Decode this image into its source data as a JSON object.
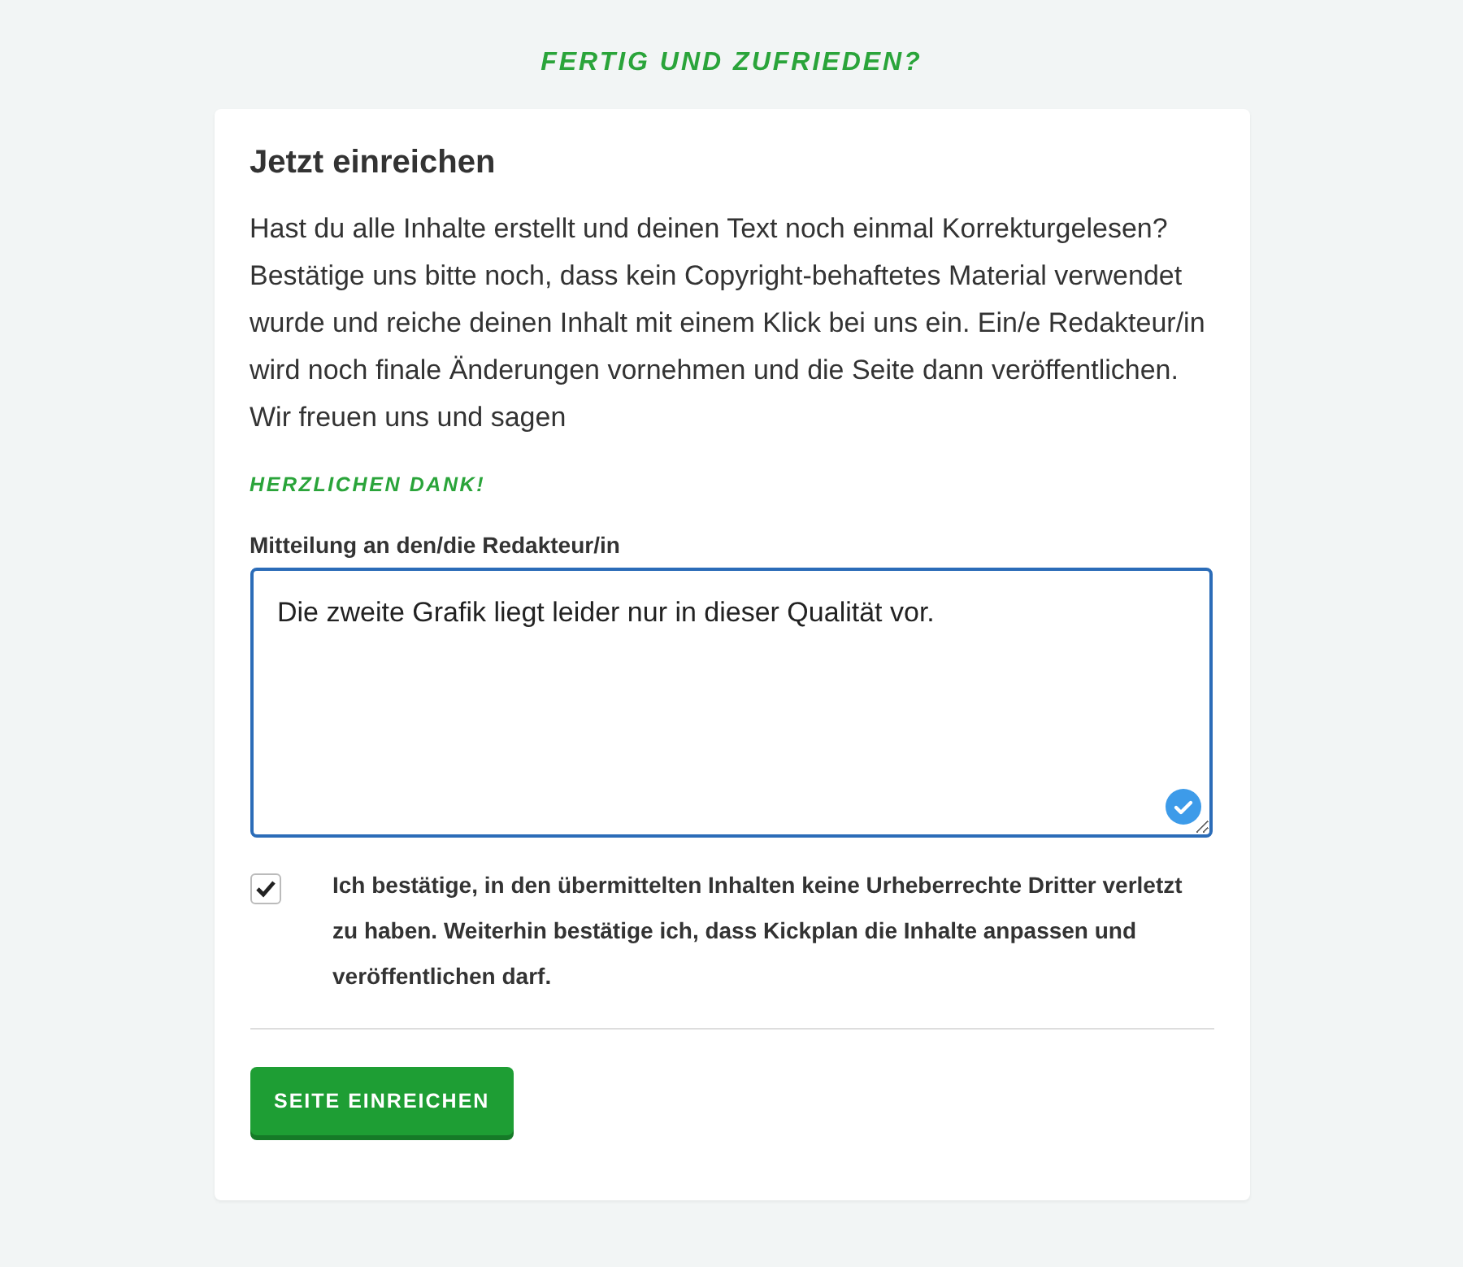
{
  "heading": "FERTIG UND ZUFRIEDEN?",
  "card": {
    "title": "Jetzt einreichen",
    "intro": "Hast du alle Inhalte erstellt und deinen Text noch einmal Korrekturgelesen? Bestätige uns bitte noch, dass kein Copyright-behaftetes Material verwendet wurde und reiche deinen Inhalt mit einem Klick bei uns ein. Ein/e Redakteur/in wird noch finale Änderungen vornehmen und die Seite dann veröffentlichen. Wir freuen uns und sagen",
    "thanks": "HERZLICHEN DANK!",
    "message": {
      "label": "Mitteilung an den/die Redakteur/in",
      "value": "Die zweite Grafik liegt leider nur in dieser Qualität vor.",
      "valid": true
    },
    "confirm": {
      "checked": true,
      "text": "Ich bestätige, in den übermittelten Inhalten keine Urheberrechte Dritter verletzt zu haben. Weiterhin bestätige ich, dass Kickplan die Inhalte anpassen und veröffentlichen darf."
    },
    "submit": "SEITE EINREICHEN"
  }
}
